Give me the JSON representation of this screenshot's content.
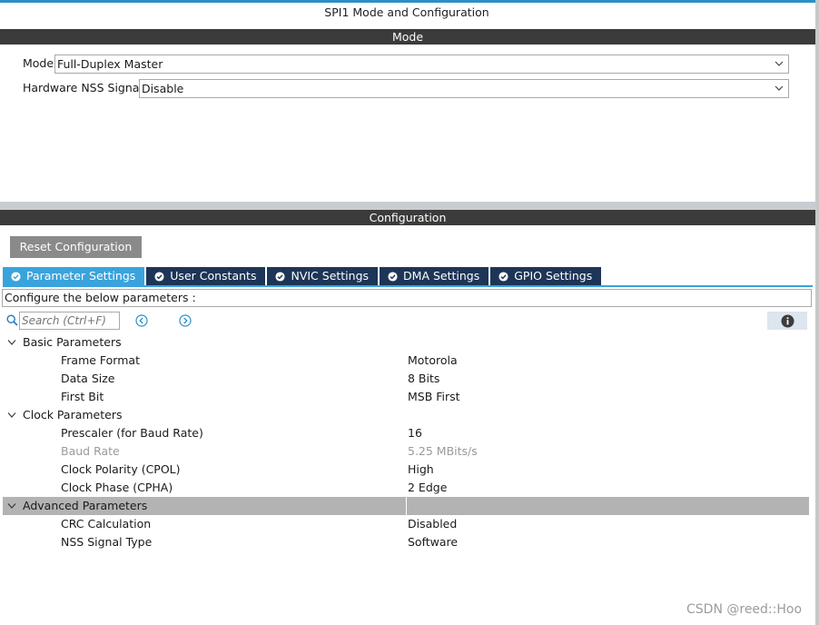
{
  "window": {
    "title": "SPI1 Mode and Configuration"
  },
  "mode_section": {
    "header": "Mode",
    "mode_label": "Mode",
    "mode_value": "Full-Duplex Master",
    "nss_label": "Hardware NSS Signal",
    "nss_value": "Disable"
  },
  "config_section": {
    "header": "Configuration",
    "reset_button": "Reset Configuration",
    "tabs": [
      {
        "label": "Parameter Settings",
        "active": true
      },
      {
        "label": "User Constants",
        "active": false
      },
      {
        "label": "NVIC Settings",
        "active": false
      },
      {
        "label": "DMA Settings",
        "active": false
      },
      {
        "label": "GPIO Settings",
        "active": false
      }
    ],
    "hint": "Configure the below parameters :",
    "search_placeholder": "Search (Ctrl+F)"
  },
  "parameters": {
    "basic": {
      "label": "Basic Parameters",
      "items": [
        {
          "name": "Frame Format",
          "value": "Motorola"
        },
        {
          "name": "Data Size",
          "value": "8 Bits"
        },
        {
          "name": "First Bit",
          "value": "MSB First"
        }
      ]
    },
    "clock": {
      "label": "Clock Parameters",
      "items": [
        {
          "name": "Prescaler (for Baud Rate)",
          "value": "16"
        },
        {
          "name": "Baud Rate",
          "value": "5.25 MBits/s"
        },
        {
          "name": "Clock Polarity (CPOL)",
          "value": "High"
        },
        {
          "name": "Clock Phase (CPHA)",
          "value": "2 Edge"
        }
      ]
    },
    "advanced": {
      "label": "Advanced Parameters",
      "items": [
        {
          "name": "CRC Calculation",
          "value": "Disabled"
        },
        {
          "name": "NSS Signal Type",
          "value": "Software"
        }
      ]
    }
  },
  "watermark": "CSDN @reed::Hoo",
  "colors": {
    "accent": "#3aa3dc",
    "tab_inactive": "#1d3557",
    "section_bar": "#3b3b3b",
    "highlight_row": "#b3b3b3"
  },
  "icons": {
    "search": "search-icon",
    "prev": "chevron-left-circle-icon",
    "next": "chevron-right-circle-icon",
    "info": "info-icon",
    "tab_check": "check-circle-icon",
    "dropdown": "chevron-down-icon",
    "expand": "chevron-down-icon"
  }
}
